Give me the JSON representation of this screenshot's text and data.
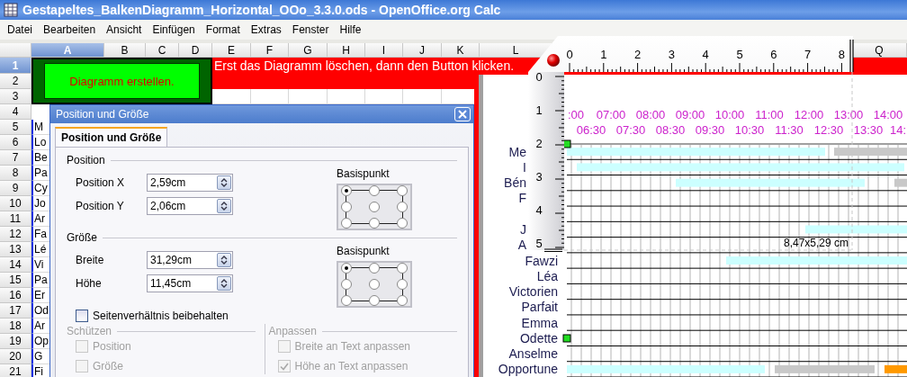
{
  "window": {
    "title": "Gestapeltes_BalkenDiagramm_Horizontal_OOo_3.3.0.ods - OpenOffice.org Calc"
  },
  "menu": [
    "Datei",
    "Bearbeiten",
    "Ansicht",
    "Einfügen",
    "Format",
    "Extras",
    "Fenster",
    "Hilfe"
  ],
  "sheet": {
    "columns": [
      {
        "label": "A",
        "selected": true
      },
      {
        "label": "B",
        "selected": false
      },
      {
        "label": "C",
        "selected": false
      },
      {
        "label": "D",
        "selected": false
      },
      {
        "label": "E",
        "selected": false
      },
      {
        "label": "F",
        "selected": false
      },
      {
        "label": "G",
        "selected": false
      },
      {
        "label": "H",
        "selected": false
      },
      {
        "label": "I",
        "selected": false
      },
      {
        "label": "J",
        "selected": false
      },
      {
        "label": "K",
        "selected": false
      },
      {
        "label": "L",
        "selected": false
      },
      {
        "label": "Q",
        "selected": false
      }
    ],
    "rows": [
      {
        "label": "1",
        "selected": true
      },
      {
        "label": "2",
        "selected": false
      },
      {
        "label": "3",
        "selected": false
      },
      {
        "label": "4",
        "selected": false
      },
      {
        "label": "5",
        "selected": false
      },
      {
        "label": "6",
        "selected": false
      },
      {
        "label": "7",
        "selected": false
      },
      {
        "label": "8",
        "selected": false
      },
      {
        "label": "9",
        "selected": false
      },
      {
        "label": "10",
        "selected": false
      },
      {
        "label": "11",
        "selected": false
      },
      {
        "label": "12",
        "selected": false
      },
      {
        "label": "13",
        "selected": false
      },
      {
        "label": "14",
        "selected": false
      },
      {
        "label": "15",
        "selected": false
      },
      {
        "label": "16",
        "selected": false
      },
      {
        "label": "17",
        "selected": false
      },
      {
        "label": "18",
        "selected": false
      },
      {
        "label": "19",
        "selected": false
      },
      {
        "label": "20",
        "selected": false
      },
      {
        "label": "21",
        "selected": false
      }
    ],
    "button": "Diagramm erstellen.",
    "note": "Erst das Diagramm löschen, dann den Button klicken.",
    "column_a": [
      "M",
      "Lo",
      "Be",
      "Pa",
      "Cy",
      "Jo",
      "Ar",
      "Fa",
      "Lé",
      "Vi",
      "Pa",
      "Er",
      "Od",
      "Ar",
      "Op",
      "G",
      "Fi"
    ]
  },
  "dialog": {
    "title": "Position und Größe",
    "tabs": [
      {
        "label": "Position und Größe",
        "selected": true
      }
    ],
    "sections": [
      {
        "heading": "Position",
        "fields": [
          {
            "label": "Position X",
            "value": "2,59cm"
          },
          {
            "label": "Position Y",
            "value": "2,06cm"
          }
        ],
        "base_point": {
          "label": "Basispunkt",
          "points": [
            {
              "selected": true
            },
            {
              "selected": false
            },
            {
              "selected": false
            },
            {
              "selected": false
            },
            {
              "selected": false
            },
            {
              "selected": false
            },
            {
              "selected": false
            },
            {
              "selected": false
            },
            {
              "selected": false
            }
          ]
        }
      },
      {
        "heading": "Größe",
        "fields": [
          {
            "label": "Breite",
            "value": "31,29cm"
          },
          {
            "label": "Höhe",
            "value": "11,45cm"
          }
        ],
        "base_point": {
          "label": "Basispunkt",
          "points": [
            {
              "selected": true
            },
            {
              "selected": false
            },
            {
              "selected": false
            },
            {
              "selected": false
            },
            {
              "selected": false
            },
            {
              "selected": false
            },
            {
              "selected": false
            },
            {
              "selected": false
            },
            {
              "selected": false
            }
          ]
        }
      }
    ],
    "keep_ratio": {
      "label": "Seitenverhältnis beibehalten",
      "checked": false,
      "disabled": false
    },
    "groups": [
      {
        "heading": "Schützen",
        "disabled": true,
        "options": [
          {
            "label": "Position",
            "checked": false,
            "disabled": true
          },
          {
            "label": "Größe",
            "checked": false,
            "disabled": true
          }
        ]
      },
      {
        "heading": "Anpassen",
        "disabled": true,
        "options": [
          {
            "label": "Breite an Text anpassen",
            "checked": false,
            "disabled": true
          },
          {
            "label": "Höhe an Text anpassen",
            "checked": true,
            "disabled": true
          }
        ]
      }
    ]
  },
  "chart": {
    "rows": [
      {
        "kind": "labeled",
        "label": "Me"
      },
      {
        "kind": "labeled",
        "label": "I"
      },
      {
        "kind": "labeled",
        "label": "Bén"
      },
      {
        "kind": "labeled",
        "label": "F"
      },
      {
        "kind": "blank"
      },
      {
        "kind": "labeled",
        "label": "J"
      },
      {
        "kind": "labeled",
        "label": "A"
      },
      {
        "kind": "labeled",
        "label": "Fawzi"
      },
      {
        "kind": "labeled",
        "label": "Léa"
      },
      {
        "kind": "labeled",
        "label": "Victorien"
      },
      {
        "kind": "labeled",
        "label": "Parfait"
      },
      {
        "kind": "labeled",
        "label": "Emma"
      },
      {
        "kind": "labeled",
        "label": "Odette"
      },
      {
        "kind": "labeled",
        "label": "Anselme"
      },
      {
        "kind": "labeled",
        "label": "Opportune"
      }
    ],
    "time_labels_top": [
      ":00",
      "07:00",
      "08:00",
      "09:00",
      "10:00",
      "11:00",
      "12:00",
      "13:00",
      "14:00"
    ],
    "time_labels_bottom": [
      "06:30",
      "07:30",
      "08:30",
      "09:30",
      "10:30",
      "11:30",
      "12:30",
      "13:30",
      "14:"
    ]
  },
  "ruler": {
    "x_labels": [
      "0",
      "1",
      "2",
      "3",
      "4",
      "5",
      "6",
      "7",
      "8"
    ],
    "y_labels": [
      "0",
      "1",
      "2",
      "3",
      "4",
      "5"
    ],
    "size_label": "8,47x5,29 cm"
  }
}
